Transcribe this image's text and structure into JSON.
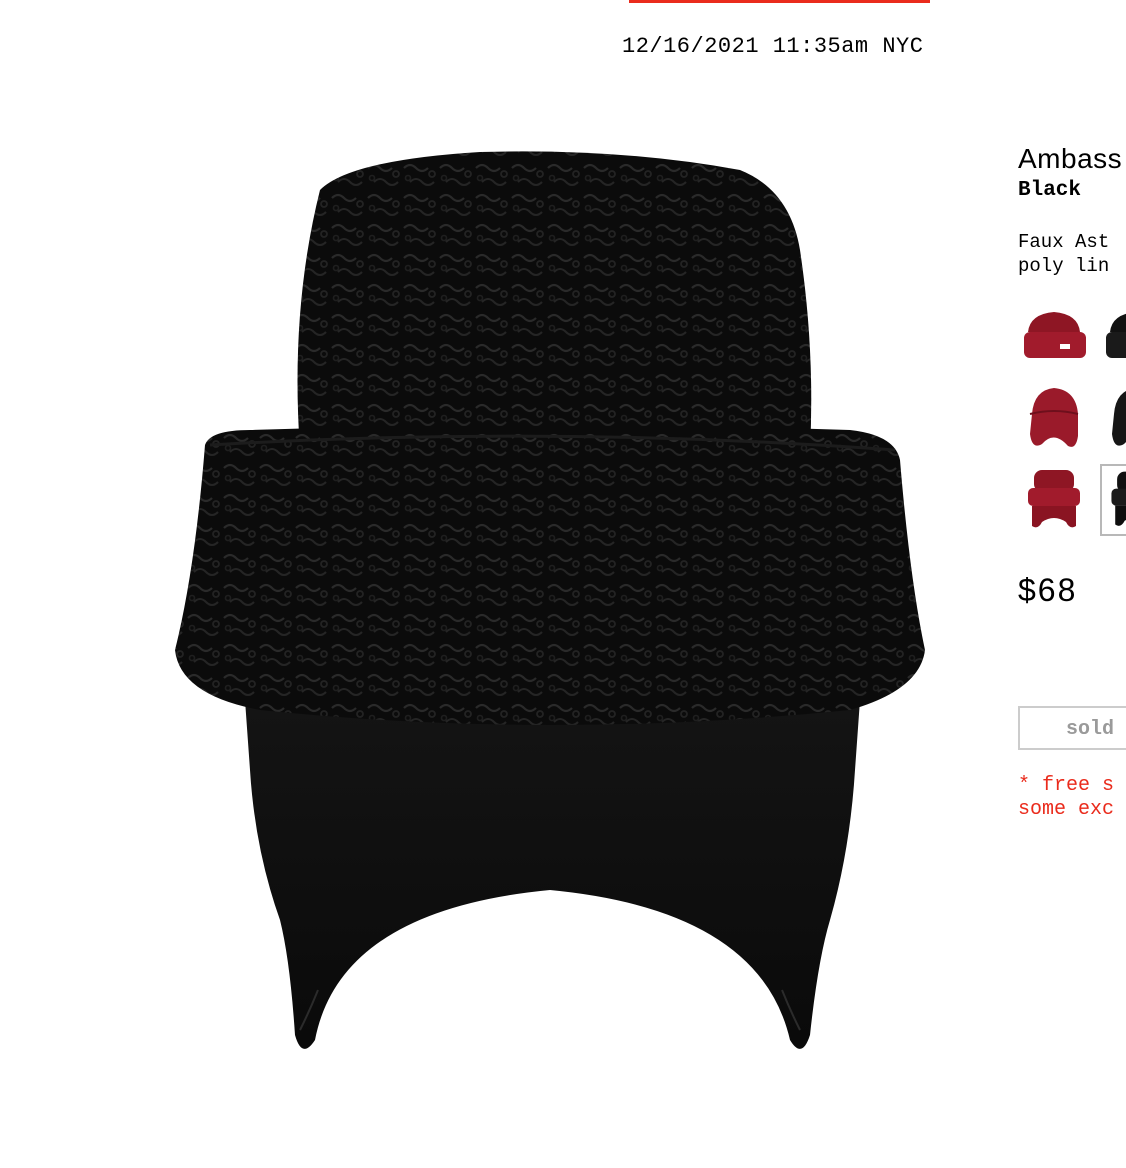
{
  "header": {
    "timestamp": "12/16/2021 11:35am NYC",
    "accent_color": "#ea2b1c"
  },
  "product": {
    "name": "Ambass",
    "color": "Black",
    "description_lines": [
      "Faux Ast",
      "poly lin"
    ],
    "price": "$68",
    "status_button": "sold",
    "shipping_note_lines": [
      "* free s",
      "some exc"
    ],
    "image_icon": "trapper-hat-image"
  },
  "swatches": [
    {
      "color": "red",
      "style": "beanie"
    },
    {
      "color": "black",
      "style": "beanie"
    },
    {
      "color": "red",
      "style": "earflap"
    },
    {
      "color": "black",
      "style": "earflap"
    },
    {
      "color": "red",
      "style": "trapper"
    },
    {
      "color": "black",
      "style": "trapper",
      "selected": true
    }
  ]
}
